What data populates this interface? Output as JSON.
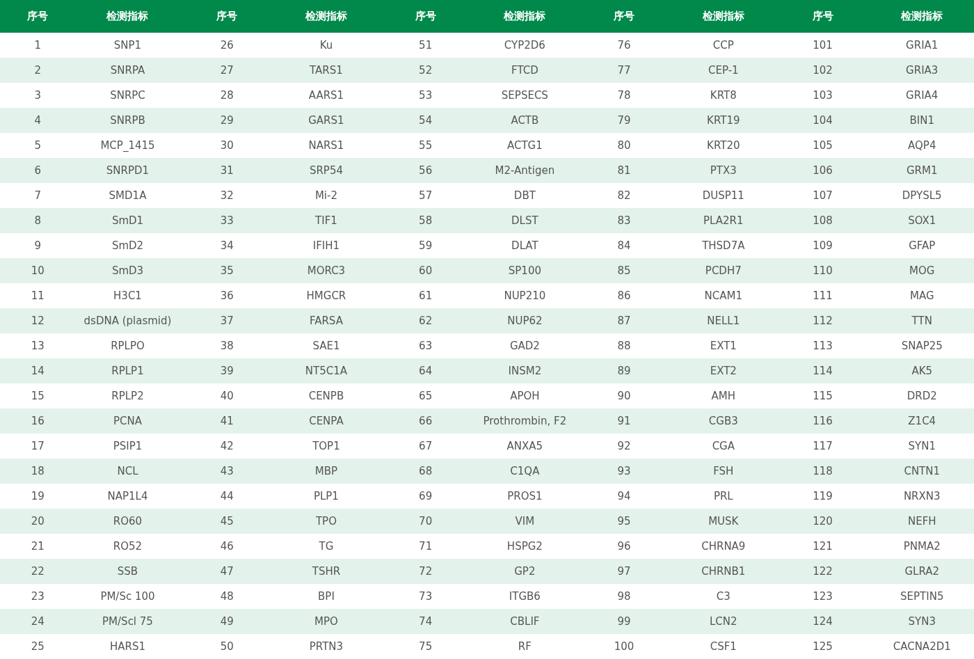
{
  "table": {
    "columns": [
      "序号",
      "检测指标",
      "序号",
      "检测指标",
      "序号",
      "检测指标",
      "序号",
      "检测指标",
      "序号",
      "检测指标"
    ],
    "rows": [
      [
        "1",
        "SNP1",
        "26",
        "Ku",
        "51",
        "CYP2D6",
        "76",
        "CCP",
        "101",
        "GRIA1"
      ],
      [
        "2",
        "SNRPA",
        "27",
        "TARS1",
        "52",
        "FTCD",
        "77",
        "CEP-1",
        "102",
        "GRIA3"
      ],
      [
        "3",
        "SNRPC",
        "28",
        "AARS1",
        "53",
        "SEPSECS",
        "78",
        "KRT8",
        "103",
        "GRIA4"
      ],
      [
        "4",
        "SNRPB",
        "29",
        "GARS1",
        "54",
        "ACTB",
        "79",
        "KRT19",
        "104",
        "BIN1"
      ],
      [
        "5",
        "MCP_1415",
        "30",
        "NARS1",
        "55",
        "ACTG1",
        "80",
        "KRT20",
        "105",
        "AQP4"
      ],
      [
        "6",
        "SNRPD1",
        "31",
        "SRP54",
        "56",
        "M2-Antigen",
        "81",
        "PTX3",
        "106",
        "GRM1"
      ],
      [
        "7",
        "SMD1A",
        "32",
        "Mi-2",
        "57",
        "DBT",
        "82",
        "DUSP11",
        "107",
        "DPYSL5"
      ],
      [
        "8",
        "SmD1",
        "33",
        "TIF1",
        "58",
        "DLST",
        "83",
        "PLA2R1",
        "108",
        "SOX1"
      ],
      [
        "9",
        "SmD2",
        "34",
        "IFIH1",
        "59",
        "DLAT",
        "84",
        "THSD7A",
        "109",
        "GFAP"
      ],
      [
        "10",
        "SmD3",
        "35",
        "MORC3",
        "60",
        "SP100",
        "85",
        "PCDH7",
        "110",
        "MOG"
      ],
      [
        "11",
        "H3C1",
        "36",
        "HMGCR",
        "61",
        "NUP210",
        "86",
        "NCAM1",
        "111",
        "MAG"
      ],
      [
        "12",
        "dsDNA (plasmid)",
        "37",
        "FARSA",
        "62",
        "NUP62",
        "87",
        "NELL1",
        "112",
        "TTN"
      ],
      [
        "13",
        "RPLPO",
        "38",
        "SAE1",
        "63",
        "GAD2",
        "88",
        "EXT1",
        "113",
        "SNAP25"
      ],
      [
        "14",
        "RPLP1",
        "39",
        "NT5C1A",
        "64",
        "INSM2",
        "89",
        "EXT2",
        "114",
        "AK5"
      ],
      [
        "15",
        "RPLP2",
        "40",
        "CENPB",
        "65",
        "APOH",
        "90",
        "AMH",
        "115",
        "DRD2"
      ],
      [
        "16",
        "PCNA",
        "41",
        "CENPA",
        "66",
        "Prothrombin, F2",
        "91",
        "CGB3",
        "116",
        "Z1C4"
      ],
      [
        "17",
        "PSIP1",
        "42",
        "TOP1",
        "67",
        "ANXA5",
        "92",
        "CGA",
        "117",
        "SYN1"
      ],
      [
        "18",
        "NCL",
        "43",
        "MBP",
        "68",
        "C1QA",
        "93",
        "FSH",
        "118",
        "CNTN1"
      ],
      [
        "19",
        "NAP1L4",
        "44",
        "PLP1",
        "69",
        "PROS1",
        "94",
        "PRL",
        "119",
        "NRXN3"
      ],
      [
        "20",
        "RO60",
        "45",
        "TPO",
        "70",
        "VIM",
        "95",
        "MUSK",
        "120",
        "NEFH"
      ],
      [
        "21",
        "RO52",
        "46",
        "TG",
        "71",
        "HSPG2",
        "96",
        "CHRNA9",
        "121",
        "PNMA2"
      ],
      [
        "22",
        "SSB",
        "47",
        "TSHR",
        "72",
        "GP2",
        "97",
        "CHRNB1",
        "122",
        "GLRA2"
      ],
      [
        "23",
        "PM/Sc 100",
        "48",
        "BPI",
        "73",
        "ITGB6",
        "98",
        "C3",
        "123",
        "SEPTIN5"
      ],
      [
        "24",
        "PM/Scl 75",
        "49",
        "MPO",
        "74",
        "CBLIF",
        "99",
        "LCN2",
        "124",
        "SYN3"
      ],
      [
        "25",
        "HARS1",
        "50",
        "PRTN3",
        "75",
        "RF",
        "100",
        "CSF1",
        "125",
        "CACNA2D1"
      ]
    ]
  }
}
